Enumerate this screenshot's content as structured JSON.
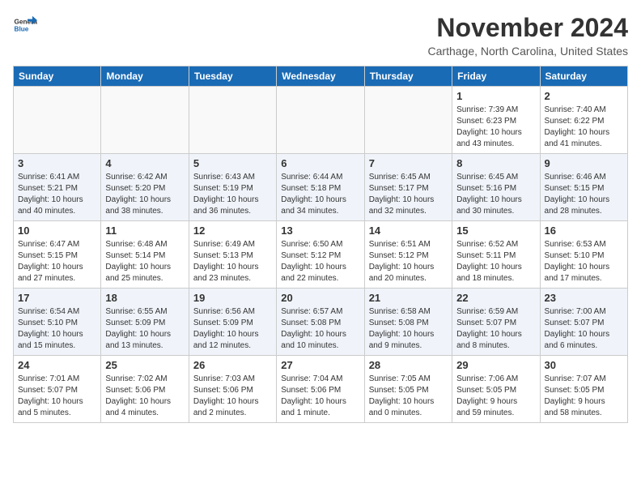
{
  "header": {
    "logo_general": "General",
    "logo_blue": "Blue",
    "month_title": "November 2024",
    "location": "Carthage, North Carolina, United States"
  },
  "weekdays": [
    "Sunday",
    "Monday",
    "Tuesday",
    "Wednesday",
    "Thursday",
    "Friday",
    "Saturday"
  ],
  "weeks": [
    [
      {
        "day": "",
        "info": ""
      },
      {
        "day": "",
        "info": ""
      },
      {
        "day": "",
        "info": ""
      },
      {
        "day": "",
        "info": ""
      },
      {
        "day": "",
        "info": ""
      },
      {
        "day": "1",
        "info": "Sunrise: 7:39 AM\nSunset: 6:23 PM\nDaylight: 10 hours\nand 43 minutes."
      },
      {
        "day": "2",
        "info": "Sunrise: 7:40 AM\nSunset: 6:22 PM\nDaylight: 10 hours\nand 41 minutes."
      }
    ],
    [
      {
        "day": "3",
        "info": "Sunrise: 6:41 AM\nSunset: 5:21 PM\nDaylight: 10 hours\nand 40 minutes."
      },
      {
        "day": "4",
        "info": "Sunrise: 6:42 AM\nSunset: 5:20 PM\nDaylight: 10 hours\nand 38 minutes."
      },
      {
        "day": "5",
        "info": "Sunrise: 6:43 AM\nSunset: 5:19 PM\nDaylight: 10 hours\nand 36 minutes."
      },
      {
        "day": "6",
        "info": "Sunrise: 6:44 AM\nSunset: 5:18 PM\nDaylight: 10 hours\nand 34 minutes."
      },
      {
        "day": "7",
        "info": "Sunrise: 6:45 AM\nSunset: 5:17 PM\nDaylight: 10 hours\nand 32 minutes."
      },
      {
        "day": "8",
        "info": "Sunrise: 6:45 AM\nSunset: 5:16 PM\nDaylight: 10 hours\nand 30 minutes."
      },
      {
        "day": "9",
        "info": "Sunrise: 6:46 AM\nSunset: 5:15 PM\nDaylight: 10 hours\nand 28 minutes."
      }
    ],
    [
      {
        "day": "10",
        "info": "Sunrise: 6:47 AM\nSunset: 5:15 PM\nDaylight: 10 hours\nand 27 minutes."
      },
      {
        "day": "11",
        "info": "Sunrise: 6:48 AM\nSunset: 5:14 PM\nDaylight: 10 hours\nand 25 minutes."
      },
      {
        "day": "12",
        "info": "Sunrise: 6:49 AM\nSunset: 5:13 PM\nDaylight: 10 hours\nand 23 minutes."
      },
      {
        "day": "13",
        "info": "Sunrise: 6:50 AM\nSunset: 5:12 PM\nDaylight: 10 hours\nand 22 minutes."
      },
      {
        "day": "14",
        "info": "Sunrise: 6:51 AM\nSunset: 5:12 PM\nDaylight: 10 hours\nand 20 minutes."
      },
      {
        "day": "15",
        "info": "Sunrise: 6:52 AM\nSunset: 5:11 PM\nDaylight: 10 hours\nand 18 minutes."
      },
      {
        "day": "16",
        "info": "Sunrise: 6:53 AM\nSunset: 5:10 PM\nDaylight: 10 hours\nand 17 minutes."
      }
    ],
    [
      {
        "day": "17",
        "info": "Sunrise: 6:54 AM\nSunset: 5:10 PM\nDaylight: 10 hours\nand 15 minutes."
      },
      {
        "day": "18",
        "info": "Sunrise: 6:55 AM\nSunset: 5:09 PM\nDaylight: 10 hours\nand 13 minutes."
      },
      {
        "day": "19",
        "info": "Sunrise: 6:56 AM\nSunset: 5:09 PM\nDaylight: 10 hours\nand 12 minutes."
      },
      {
        "day": "20",
        "info": "Sunrise: 6:57 AM\nSunset: 5:08 PM\nDaylight: 10 hours\nand 10 minutes."
      },
      {
        "day": "21",
        "info": "Sunrise: 6:58 AM\nSunset: 5:08 PM\nDaylight: 10 hours\nand 9 minutes."
      },
      {
        "day": "22",
        "info": "Sunrise: 6:59 AM\nSunset: 5:07 PM\nDaylight: 10 hours\nand 8 minutes."
      },
      {
        "day": "23",
        "info": "Sunrise: 7:00 AM\nSunset: 5:07 PM\nDaylight: 10 hours\nand 6 minutes."
      }
    ],
    [
      {
        "day": "24",
        "info": "Sunrise: 7:01 AM\nSunset: 5:07 PM\nDaylight: 10 hours\nand 5 minutes."
      },
      {
        "day": "25",
        "info": "Sunrise: 7:02 AM\nSunset: 5:06 PM\nDaylight: 10 hours\nand 4 minutes."
      },
      {
        "day": "26",
        "info": "Sunrise: 7:03 AM\nSunset: 5:06 PM\nDaylight: 10 hours\nand 2 minutes."
      },
      {
        "day": "27",
        "info": "Sunrise: 7:04 AM\nSunset: 5:06 PM\nDaylight: 10 hours\nand 1 minute."
      },
      {
        "day": "28",
        "info": "Sunrise: 7:05 AM\nSunset: 5:05 PM\nDaylight: 10 hours\nand 0 minutes."
      },
      {
        "day": "29",
        "info": "Sunrise: 7:06 AM\nSunset: 5:05 PM\nDaylight: 9 hours\nand 59 minutes."
      },
      {
        "day": "30",
        "info": "Sunrise: 7:07 AM\nSunset: 5:05 PM\nDaylight: 9 hours\nand 58 minutes."
      }
    ]
  ]
}
